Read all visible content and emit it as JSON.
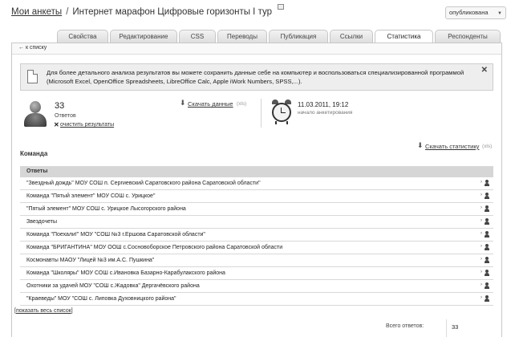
{
  "header": {
    "breadcrumb_link": "Мои анкеты",
    "separator": "/",
    "title": "Интернет марафон Цифровые горизонты I тур",
    "status": "опубликована"
  },
  "tabs": [
    {
      "label": "Свойства"
    },
    {
      "label": "Редактирование"
    },
    {
      "label": "CSS"
    },
    {
      "label": "Переводы"
    },
    {
      "label": "Публикация"
    },
    {
      "label": "Ссылки"
    },
    {
      "label": "Статистика"
    },
    {
      "label": "Респонденты"
    }
  ],
  "active_tab": "Статистика",
  "back_link": "← к списку",
  "info": {
    "text": "Для более детального анализа результатов вы можете сохранить данные себе на компьютер и воспользоваться специализированной программой (Microsoft Excel, OpenOffice Spreadsheets, LibreOffice Calc, Apple iWork Numbers, SPSS,...).",
    "close": "✕"
  },
  "stats": {
    "responses_count": "33",
    "responses_label": "Ответов",
    "clear_link": "очистить результаты",
    "download_data": "Скачать данные",
    "download_data_format": "(xls)",
    "date": "11.03.2011, 19:12",
    "date_label": "начало анкетирования"
  },
  "section": {
    "title": "Команда",
    "download_stats": "Скачать статистику",
    "download_stats_format": "(xls)"
  },
  "table": {
    "header": "Ответы",
    "rows": [
      "\"Звездный дождь\" МОУ СОШ п. Сергиевский Саратовского района Саратовской области\"",
      "Команда \"Пятый элемент\" МОУ СОШ с. Урицкое\"",
      "\"Пятый элемент\" МОУ СОШ с. Урицкое Лысогорского района",
      "Звездочеты",
      "Команда \"Поехали!\" МОУ \"СОШ №3 г.Ершова Саратовской области\"",
      "Команда \"БРИГАНТИНА\" МОУ ООШ с.Сосновоборское Петровского района Саратовской области",
      "Космонавты МАОУ \"Лицей №3 им.А.С. Пушкина\"",
      "Команда \"Школяры\" МОУ СОШ с.Ивановка Базарно-Карабулакского района",
      "Охотники за удачей МОУ \"СОШ с.Жадовка\" Дергачёвского района",
      "\"Краеведы\" МОУ \"СОШ с. Липовка Духовницкого района\""
    ],
    "show_all": "показать весь список"
  },
  "totals": {
    "label": "Всего ответов:",
    "value": "33"
  }
}
